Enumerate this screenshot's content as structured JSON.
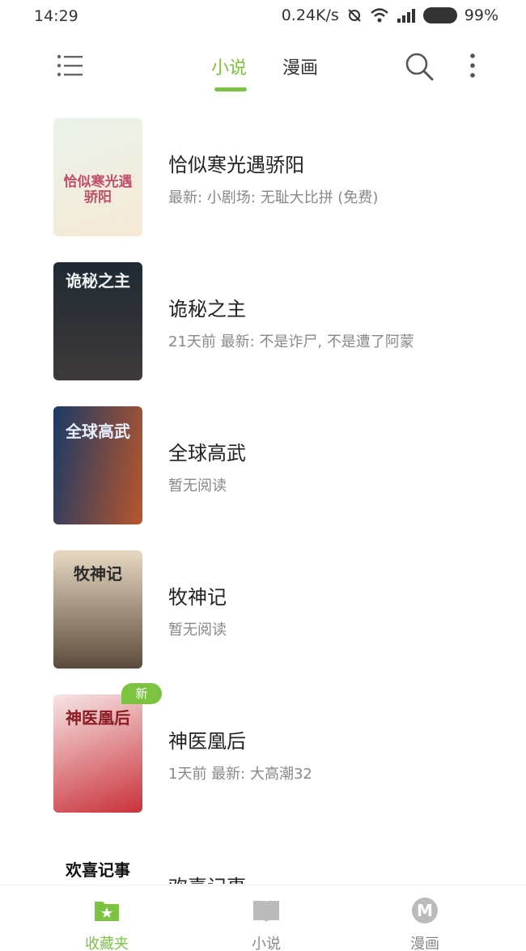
{
  "status_bar": {
    "time": "14:29",
    "speed": "0.24K/s",
    "battery": "99%"
  },
  "header": {
    "tabs": [
      {
        "label": "小说",
        "active": true
      },
      {
        "label": "漫画",
        "active": false
      }
    ],
    "icons": [
      "menu-icon",
      "search-icon",
      "more-icon"
    ]
  },
  "books": [
    {
      "title": "恰似寒光遇骄阳",
      "subtitle": "最新: 小剧场: 无耻大比拼 (免费)",
      "cover_text": "恰似寒光遇骄阳",
      "cover_colors": [
        "#e9f3ea",
        "#f6e9d6"
      ],
      "is_new": false
    },
    {
      "title": "诡秘之主",
      "subtitle": "21天前 最新: 不是诈尸, 不是遭了阿蒙",
      "cover_text": "诡秘之主",
      "cover_colors": [
        "#1f2a33",
        "#3e3a3a"
      ],
      "is_new": false
    },
    {
      "title": "全球高武",
      "subtitle": "暂无阅读",
      "cover_text": "全球高武",
      "cover_colors": [
        "#1a3a66",
        "#b8562c"
      ],
      "is_new": false
    },
    {
      "title": "牧神记",
      "subtitle": "暂无阅读",
      "cover_text": "牧神记",
      "cover_colors": [
        "#e7d9c3",
        "#5b4b3c"
      ],
      "is_new": false
    },
    {
      "title": "神医凰后",
      "subtitle": "1天前 最新: 大高潮32",
      "cover_text": "神医凰后",
      "cover_colors": [
        "#f7e6e6",
        "#c9313a"
      ],
      "is_new": true,
      "badge": "新"
    },
    {
      "title": "欢喜记事",
      "subtitle": "",
      "cover_text": "欢喜记事",
      "cover_colors": [
        "#ffffff",
        "#f3f3f3"
      ],
      "is_new": false
    }
  ],
  "bottom_nav": [
    {
      "label": "收藏夹",
      "icon": "folder-star-icon",
      "active": true
    },
    {
      "label": "小说",
      "icon": "book-icon",
      "active": false
    },
    {
      "label": "漫画",
      "icon": "m-circle-icon",
      "active": false
    }
  ],
  "colors": {
    "accent": "#7cc341",
    "text_primary": "#222222",
    "text_secondary": "#888888"
  }
}
